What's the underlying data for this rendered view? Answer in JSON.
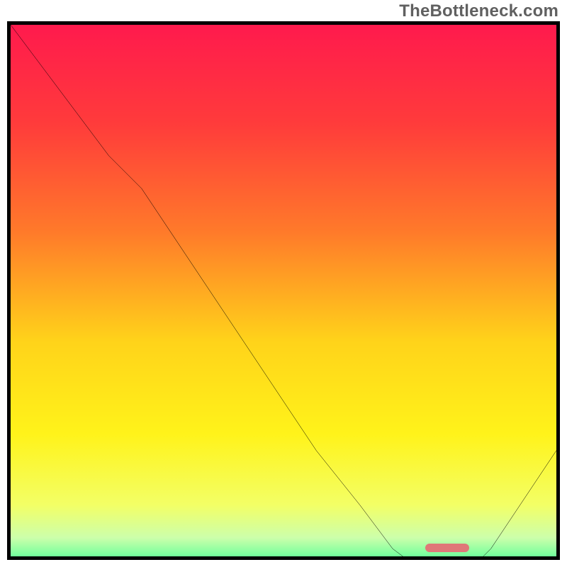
{
  "watermark": "TheBottleneck.com",
  "colors": {
    "border": "#000000",
    "watermark": "#606060",
    "marker": "#e07878",
    "gradient_stops": [
      {
        "pct": 0,
        "color": "#ff1a4d"
      },
      {
        "pct": 18,
        "color": "#ff3b3b"
      },
      {
        "pct": 38,
        "color": "#ff7a2a"
      },
      {
        "pct": 58,
        "color": "#ffd31a"
      },
      {
        "pct": 75,
        "color": "#fff31a"
      },
      {
        "pct": 88,
        "color": "#f3ff66"
      },
      {
        "pct": 94,
        "color": "#ccffab"
      },
      {
        "pct": 97,
        "color": "#7dff9e"
      },
      {
        "pct": 100,
        "color": "#00e06b"
      }
    ]
  },
  "chart_data": {
    "type": "line",
    "title": "",
    "xlabel": "",
    "ylabel": "",
    "xlim": [
      0,
      100
    ],
    "ylim": [
      0,
      100
    ],
    "notes": "Axes have no tick labels; x/y expressed as 0–100 % of plot area. y values read off vertically where 0=bottom, 100=top.",
    "series": [
      {
        "name": "bottleneck-curve",
        "x": [
          0,
          6,
          12,
          18,
          24,
          26,
          32,
          40,
          48,
          56,
          64,
          70,
          74,
          78,
          80,
          84,
          88,
          92,
          100
        ],
        "y": [
          100,
          92,
          84,
          76,
          70,
          67,
          58,
          46,
          34,
          22,
          12,
          4,
          1,
          0,
          0,
          0,
          4,
          10,
          22
        ]
      }
    ],
    "marker": {
      "name": "highlight-segment",
      "x_start": 76,
      "x_end": 84,
      "y": 0.8
    }
  }
}
